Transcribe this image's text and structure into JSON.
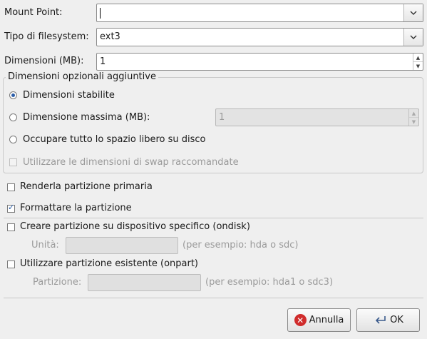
{
  "mount_point": {
    "label": "Mount Point:",
    "value": ""
  },
  "filesystem": {
    "label": "Tipo di filesystem:",
    "value": "ext3"
  },
  "size": {
    "label": "Dimensioni (MB):",
    "value": "1"
  },
  "optional": {
    "title": "Dimensioni opzionali aggiuntive",
    "fixed": "Dimensioni stabilite",
    "max": "Dimensione massima (MB):",
    "max_value": "1",
    "fill": "Occupare tutto lo spazio libero su disco",
    "swap": "Utilizzare le dimensioni di swap raccomandate"
  },
  "primary": "Renderla partizione primaria",
  "format": "Formattare la partizione",
  "ondisk": {
    "label": "Creare partizione su dispositivo specifico (ondisk)",
    "unit_label": "Unità:",
    "unit_hint": "(per esempio: hda o sdc)"
  },
  "onpart": {
    "label": "Utilizzare partizione esistente (onpart)",
    "part_label": "Partizione:",
    "part_hint": "(per esempio: hda1 o sdc3)"
  },
  "buttons": {
    "cancel": "Annulla",
    "ok": "OK"
  },
  "colors": {
    "window_bg": "#efefef",
    "accent": "#2a5da8",
    "cancel_icon": "#d02c2c"
  }
}
